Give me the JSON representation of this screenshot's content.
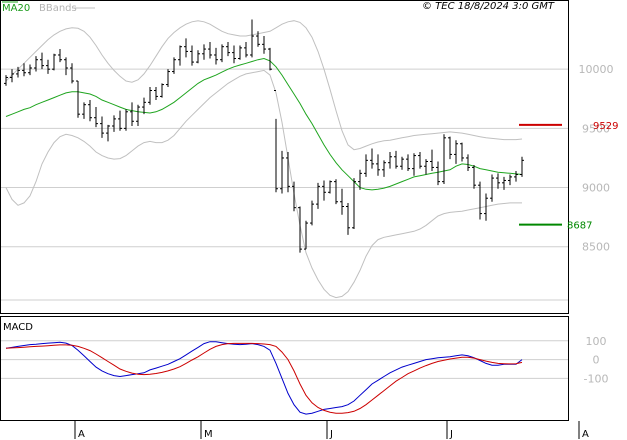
{
  "header": {
    "legend_ma": "MA20",
    "legend_bb": "BBands",
    "credit": "© TEC 18/8/2024 3:0 GMT"
  },
  "colors": {
    "ma": "#1fa51f",
    "bbands": "#c0c0c0",
    "bars": "#000000",
    "macd": "#0000cc",
    "signal": "#cc0000",
    "level_high": "#cc0000",
    "level_low": "#008800",
    "grid": "#cfcfcf"
  },
  "chart_data": [
    {
      "type": "ohlc",
      "title": "",
      "yticks": [
        8500,
        9000,
        9500,
        10000
      ],
      "ylim": [
        8050,
        10500
      ],
      "x_axis_labels": [
        {
          "label": "A",
          "at": 12
        },
        {
          "label": "M",
          "at": 33
        },
        {
          "label": "J",
          "at": 54
        },
        {
          "label": "J",
          "at": 74
        },
        {
          "label": "A",
          "at": 96
        }
      ],
      "levels": [
        {
          "name": "high",
          "label": "9529",
          "value": 9529,
          "color": "#cc0000"
        },
        {
          "name": "low",
          "label": "8687",
          "value": 8687,
          "color": "#008800"
        }
      ],
      "ohlc": [
        [
          9880,
          9950,
          9860,
          9930
        ],
        [
          9930,
          10000,
          9890,
          9960
        ],
        [
          9960,
          10020,
          9930,
          9990
        ],
        [
          9990,
          10050,
          9940,
          9970
        ],
        [
          9970,
          10040,
          9950,
          10010
        ],
        [
          10010,
          10110,
          9980,
          10080
        ],
        [
          10080,
          10140,
          10000,
          10030
        ],
        [
          10030,
          10080,
          9960,
          10000
        ],
        [
          10000,
          10130,
          9990,
          10120
        ],
        [
          10120,
          10170,
          10060,
          10080
        ],
        [
          10080,
          10100,
          9950,
          10010
        ],
        [
          10010,
          10050,
          9880,
          9900
        ],
        [
          9900,
          9900,
          9590,
          9620
        ],
        [
          9620,
          9720,
          9580,
          9700
        ],
        [
          9700,
          9740,
          9560,
          9590
        ],
        [
          9590,
          9680,
          9510,
          9540
        ],
        [
          9540,
          9600,
          9420,
          9460
        ],
        [
          9460,
          9530,
          9390,
          9520
        ],
        [
          9520,
          9610,
          9470,
          9580
        ],
        [
          9580,
          9650,
          9480,
          9500
        ],
        [
          9500,
          9660,
          9480,
          9640
        ],
        [
          9640,
          9720,
          9520,
          9560
        ],
        [
          9560,
          9700,
          9520,
          9680
        ],
        [
          9680,
          9760,
          9620,
          9720
        ],
        [
          9720,
          9850,
          9700,
          9820
        ],
        [
          9820,
          9850,
          9740,
          9770
        ],
        [
          9770,
          9880,
          9760,
          9870
        ],
        [
          9870,
          10000,
          9850,
          9980
        ],
        [
          9980,
          10100,
          9960,
          10080
        ],
        [
          10080,
          10200,
          10030,
          10190
        ],
        [
          10190,
          10260,
          10100,
          10150
        ],
        [
          10150,
          10200,
          10030,
          10060
        ],
        [
          10060,
          10160,
          10050,
          10130
        ],
        [
          10130,
          10210,
          10080,
          10170
        ],
        [
          10170,
          10230,
          10090,
          10120
        ],
        [
          10120,
          10180,
          10040,
          10080
        ],
        [
          10080,
          10210,
          10060,
          10190
        ],
        [
          10190,
          10230,
          10110,
          10140
        ],
        [
          10140,
          10200,
          10050,
          10090
        ],
        [
          10090,
          10200,
          10080,
          10180
        ],
        [
          10180,
          10230,
          10100,
          10120
        ],
        [
          10120,
          10420,
          10100,
          10280
        ],
        [
          10280,
          10320,
          10190,
          10210
        ],
        [
          10210,
          10280,
          10130,
          10170
        ],
        [
          10170,
          10180,
          9990,
          10000
        ],
        [
          9820,
          9580,
          8960,
          8990
        ],
        [
          8990,
          9310,
          8950,
          9250
        ],
        [
          9250,
          9300,
          8960,
          9010
        ],
        [
          9010,
          9050,
          8800,
          8830
        ],
        [
          8830,
          8840,
          8450,
          8480
        ],
        [
          8480,
          8720,
          8480,
          8700
        ],
        [
          8700,
          8890,
          8680,
          8860
        ],
        [
          8860,
          9040,
          8820,
          9010
        ],
        [
          9010,
          9060,
          8890,
          8960
        ],
        [
          8960,
          9060,
          8950,
          9050
        ],
        [
          9050,
          9070,
          8860,
          8880
        ],
        [
          8880,
          8990,
          8770,
          8840
        ],
        [
          8840,
          8870,
          8600,
          8660
        ],
        [
          8660,
          9080,
          8650,
          9050
        ],
        [
          9050,
          9150,
          8980,
          9120
        ],
        [
          9120,
          9280,
          9090,
          9230
        ],
        [
          9230,
          9330,
          9160,
          9200
        ],
        [
          9200,
          9280,
          9100,
          9150
        ],
        [
          9150,
          9230,
          9090,
          9210
        ],
        [
          9210,
          9300,
          9160,
          9260
        ],
        [
          9260,
          9310,
          9160,
          9180
        ],
        [
          9180,
          9260,
          9150,
          9240
        ],
        [
          9240,
          9280,
          9140,
          9160
        ],
        [
          9160,
          9290,
          9100,
          9270
        ],
        [
          9270,
          9300,
          9160,
          9180
        ],
        [
          9180,
          9240,
          9110,
          9220
        ],
        [
          9220,
          9320,
          9140,
          9170
        ],
        [
          9170,
          9220,
          9020,
          9050
        ],
        [
          9050,
          9450,
          9030,
          9420
        ],
        [
          9420,
          9430,
          9240,
          9280
        ],
        [
          9280,
          9400,
          9200,
          9370
        ],
        [
          9370,
          9380,
          9220,
          9250
        ],
        [
          9250,
          9280,
          9140,
          9170
        ],
        [
          9170,
          9190,
          8990,
          9020
        ],
        [
          9020,
          9050,
          8730,
          8780
        ],
        [
          8780,
          8950,
          8720,
          8910
        ],
        [
          8910,
          9110,
          8880,
          9080
        ],
        [
          9080,
          9120,
          8990,
          9040
        ],
        [
          9040,
          9090,
          8980,
          9060
        ],
        [
          9060,
          9110,
          9020,
          9090
        ],
        [
          9090,
          9140,
          9050,
          9110
        ],
        [
          9110,
          9260,
          9090,
          9230
        ]
      ],
      "ma20": [
        9600,
        9620,
        9640,
        9660,
        9675,
        9700,
        9720,
        9740,
        9760,
        9780,
        9800,
        9810,
        9810,
        9800,
        9790,
        9770,
        9740,
        9720,
        9700,
        9680,
        9660,
        9650,
        9640,
        9635,
        9630,
        9640,
        9660,
        9690,
        9720,
        9760,
        9800,
        9840,
        9880,
        9910,
        9930,
        9950,
        9975,
        10000,
        10020,
        10035,
        10050,
        10065,
        10080,
        10090,
        10070,
        10020,
        9950,
        9870,
        9790,
        9710,
        9620,
        9540,
        9450,
        9360,
        9280,
        9210,
        9150,
        9100,
        9050,
        9000,
        8985,
        8980,
        8985,
        8995,
        9010,
        9030,
        9050,
        9070,
        9090,
        9100,
        9110,
        9120,
        9130,
        9140,
        9150,
        9180,
        9200,
        9195,
        9180,
        9160,
        9150,
        9140,
        9130,
        9125,
        9120,
        9115,
        9110
      ],
      "bb_upper": [
        9900,
        9950,
        10000,
        10050,
        10100,
        10150,
        10200,
        10250,
        10290,
        10320,
        10340,
        10350,
        10345,
        10320,
        10270,
        10200,
        10120,
        10050,
        9990,
        9940,
        9900,
        9890,
        9910,
        9960,
        10030,
        10110,
        10190,
        10260,
        10310,
        10350,
        10380,
        10400,
        10410,
        10400,
        10380,
        10350,
        10320,
        10300,
        10290,
        10280,
        10280,
        10290,
        10300,
        10310,
        10320,
        10350,
        10380,
        10400,
        10410,
        10395,
        10350,
        10270,
        10150,
        10000,
        9830,
        9650,
        9480,
        9360,
        9320,
        9330,
        9350,
        9370,
        9385,
        9395,
        9400,
        9410,
        9420,
        9430,
        9440,
        9445,
        9450,
        9455,
        9460,
        9465,
        9470,
        9465,
        9460,
        9450,
        9440,
        9430,
        9420,
        9415,
        9410,
        9405,
        9405,
        9405,
        9410
      ],
      "bb_lower": [
        9000,
        8900,
        8850,
        8870,
        8930,
        9050,
        9200,
        9300,
        9380,
        9430,
        9450,
        9440,
        9420,
        9390,
        9350,
        9300,
        9270,
        9250,
        9240,
        9245,
        9270,
        9310,
        9350,
        9380,
        9390,
        9380,
        9380,
        9400,
        9440,
        9500,
        9560,
        9610,
        9660,
        9710,
        9760,
        9800,
        9840,
        9880,
        9910,
        9940,
        9960,
        9970,
        9980,
        9990,
        9950,
        9800,
        9550,
        9250,
        8950,
        8680,
        8450,
        8320,
        8220,
        8140,
        8090,
        8070,
        8080,
        8120,
        8200,
        8300,
        8420,
        8510,
        8560,
        8580,
        8590,
        8600,
        8610,
        8620,
        8630,
        8650,
        8680,
        8720,
        8760,
        8780,
        8790,
        8795,
        8800,
        8810,
        8820,
        8830,
        8840,
        8850,
        8860,
        8865,
        8870,
        8870,
        8870
      ]
    },
    {
      "type": "line",
      "title": "MACD",
      "yticks": [
        -100,
        0,
        100
      ],
      "ylim": [
        -300,
        200
      ],
      "series": [
        {
          "name": "macd",
          "values": [
            60,
            65,
            70,
            75,
            80,
            82,
            85,
            88,
            90,
            92,
            88,
            75,
            50,
            20,
            -10,
            -40,
            -60,
            -75,
            -85,
            -90,
            -85,
            -80,
            -75,
            -70,
            -55,
            -45,
            -35,
            -25,
            -10,
            5,
            25,
            45,
            65,
            85,
            95,
            95,
            90,
            85,
            82,
            80,
            82,
            85,
            80,
            70,
            50,
            -20,
            -100,
            -180,
            -240,
            -280,
            -290,
            -285,
            -275,
            -265,
            -260,
            -255,
            -250,
            -240,
            -220,
            -190,
            -160,
            -130,
            -110,
            -90,
            -70,
            -55,
            -40,
            -30,
            -20,
            -10,
            0,
            5,
            10,
            12,
            15,
            20,
            25,
            20,
            10,
            -5,
            -20,
            -30,
            -30,
            -25,
            -25,
            -25,
            0
          ]
        },
        {
          "name": "signal",
          "values": [
            60,
            62,
            64,
            66,
            68,
            70,
            72,
            74,
            76,
            78,
            78,
            76,
            70,
            60,
            48,
            30,
            10,
            -10,
            -30,
            -50,
            -62,
            -72,
            -78,
            -80,
            -78,
            -74,
            -68,
            -60,
            -50,
            -38,
            -20,
            -2,
            15,
            35,
            55,
            70,
            80,
            85,
            86,
            86,
            86,
            86,
            85,
            83,
            80,
            70,
            40,
            0,
            -60,
            -130,
            -190,
            -230,
            -255,
            -270,
            -280,
            -285,
            -285,
            -282,
            -275,
            -260,
            -240,
            -215,
            -190,
            -165,
            -140,
            -115,
            -95,
            -75,
            -60,
            -45,
            -32,
            -20,
            -10,
            -3,
            3,
            8,
            12,
            12,
            8,
            0,
            -8,
            -15,
            -20,
            -22,
            -23,
            -22,
            -15
          ]
        }
      ]
    }
  ]
}
